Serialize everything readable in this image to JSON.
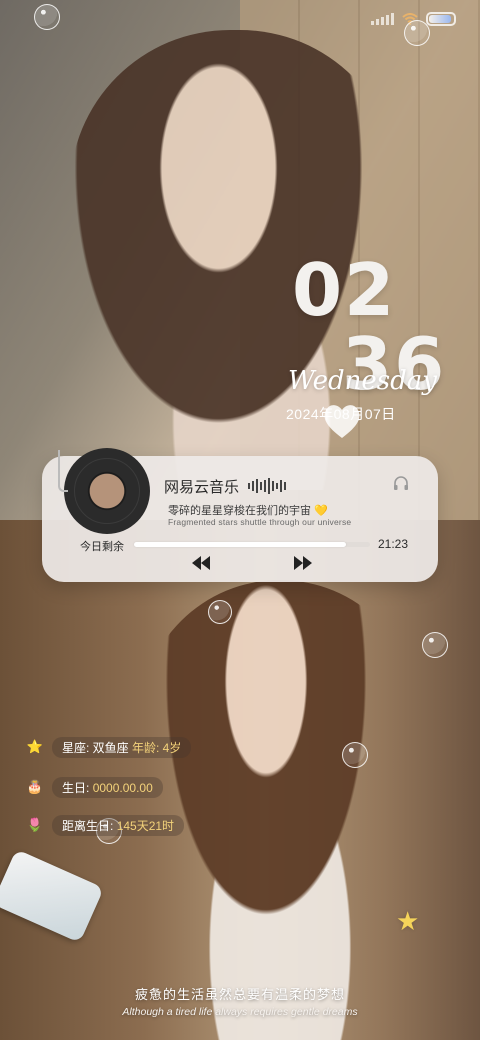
{
  "clock": {
    "hour": "02",
    "minute": "36",
    "weekday": "Wednesday",
    "date": "2024年08月07日"
  },
  "player": {
    "app_name": "网易云音乐",
    "lyric_cn": "零碎的星星穿梭在我们的宇宙 💛",
    "lyric_en": "Fragmented stars shuttle through our universe",
    "remain_label": "今日剩余",
    "remain_time": "21:23",
    "progress": 0.9
  },
  "info": {
    "zodiac": "星座: 双鱼座",
    "age": "年龄: 4岁",
    "birthday_label": "生日:",
    "birthday_value": "0000.00.00",
    "countdown_label": "距离生日:",
    "countdown_value": "145天21时"
  },
  "tagline": {
    "cn": "疲惫的生活虽然总要有温柔的梦想",
    "en": "Although a tired life always requires gentle dreams"
  },
  "colors": {
    "accent_gold": "#f3d27a",
    "card_bg": "#eeeae7"
  },
  "icons": [
    "signal-icon",
    "wifi-icon",
    "battery-icon",
    "vinyl-record-icon",
    "equalizer-icon",
    "headphones-icon",
    "previous-icon",
    "next-icon",
    "star-icon",
    "cake-icon",
    "flower-icon"
  ]
}
